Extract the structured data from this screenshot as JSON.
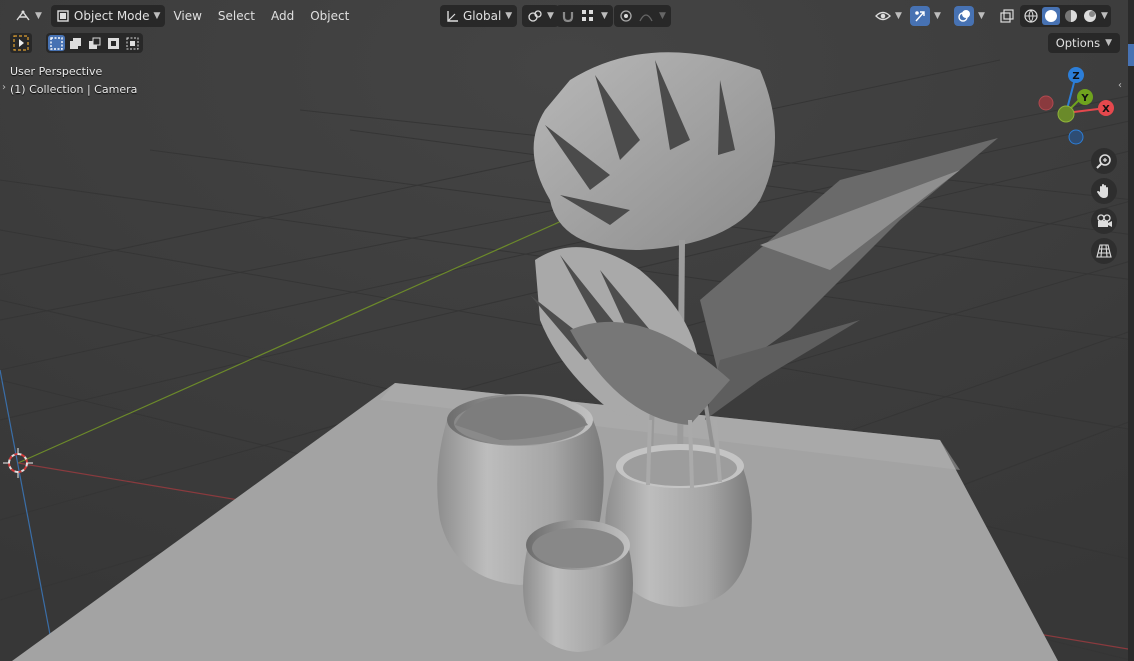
{
  "header": {
    "editor_type_icon": "viewport-editor-icon",
    "mode": "Object Mode",
    "menus": [
      "View",
      "Select",
      "Add",
      "Object"
    ],
    "orientation": "Global",
    "pivot_icon": "pivot-icon",
    "snap_icon": "magnet-icon",
    "proportional_icon": "proportional-edit-icon",
    "visibility_icon": "eye-icon",
    "gizmo_icon": "gizmo-icon",
    "overlay_icon": "overlay-icon",
    "xray_icon": "xray-icon",
    "shading_modes": [
      "wireframe",
      "solid",
      "material",
      "rendered"
    ],
    "active_shading": "solid"
  },
  "toolbar": {
    "select_tool_icon": "cursor-select-icon",
    "select_modes": [
      "new",
      "extend",
      "subtract",
      "invert",
      "intersect"
    ],
    "options_label": "Options"
  },
  "viewport": {
    "perspective_label": "User Perspective",
    "collection_label": "(1) Collection | Camera",
    "axes": {
      "x": "X",
      "y": "Y",
      "z": "Z"
    },
    "colors": {
      "x": "#e5484d",
      "y": "#6fa31e",
      "z": "#2c7ed8",
      "bg": "#3d3d3d",
      "accent": "#4772b3"
    }
  },
  "navigation": [
    "zoom-icon",
    "hand-pan-icon",
    "camera-view-icon",
    "grid-ortho-icon"
  ]
}
